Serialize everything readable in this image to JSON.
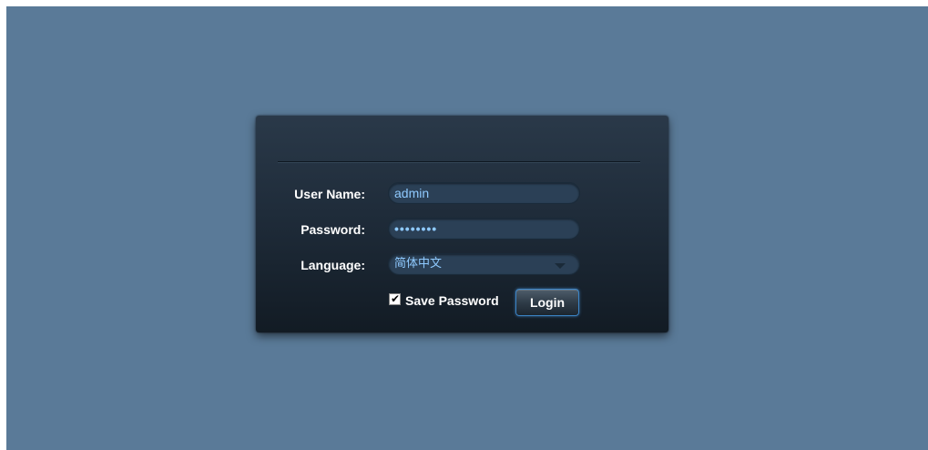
{
  "login_form": {
    "username_label": "User Name:",
    "username_value": "admin",
    "password_label": "Password:",
    "password_value": "••••••••",
    "language_label": "Language:",
    "language_selected": "简体中文",
    "save_password_label": "Save Password",
    "save_password_checked": true,
    "checkmark_glyph": "✔",
    "login_button_label": "Login"
  },
  "colors": {
    "background": "#5a7a98",
    "panel": "#1f2c3a",
    "field_text": "#8fcaff",
    "button_border": "#3b84c6"
  }
}
